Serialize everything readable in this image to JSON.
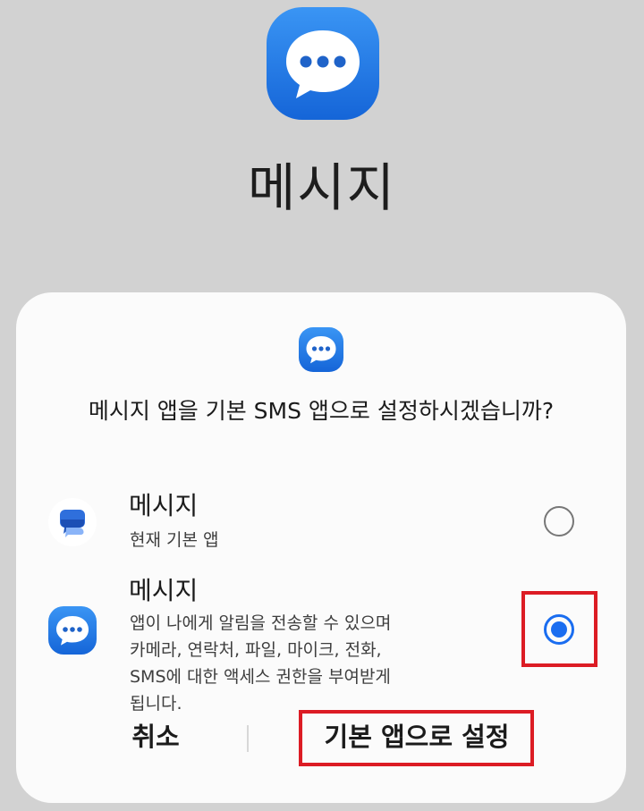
{
  "app_header": {
    "title": "메시지",
    "icon": "samsung-messages-icon"
  },
  "dialog": {
    "icon": "samsung-messages-icon",
    "question": "메시지 앱을 기본 SMS 앱으로 설정하시겠습니까?",
    "options": [
      {
        "title": "메시지",
        "subtitle": "현재 기본 앱",
        "icon": "google-messages-icon",
        "selected": false
      },
      {
        "title": "메시지",
        "subtitle": "앱이 나에게 알림을 전송할 수 있으며 카메라, 연락처, 파일, 마이크, 전화, SMS에 대한 액세스 권한을 부여받게 됩니다.",
        "icon": "samsung-messages-icon",
        "selected": true
      }
    ],
    "buttons": {
      "cancel": "취소",
      "set_default": "기본 앱으로 설정"
    }
  },
  "colors": {
    "accent": "#1a6df0",
    "highlight": "#dc1c24",
    "background": "#d2d2d2",
    "dialog": "#fbfbfb"
  }
}
